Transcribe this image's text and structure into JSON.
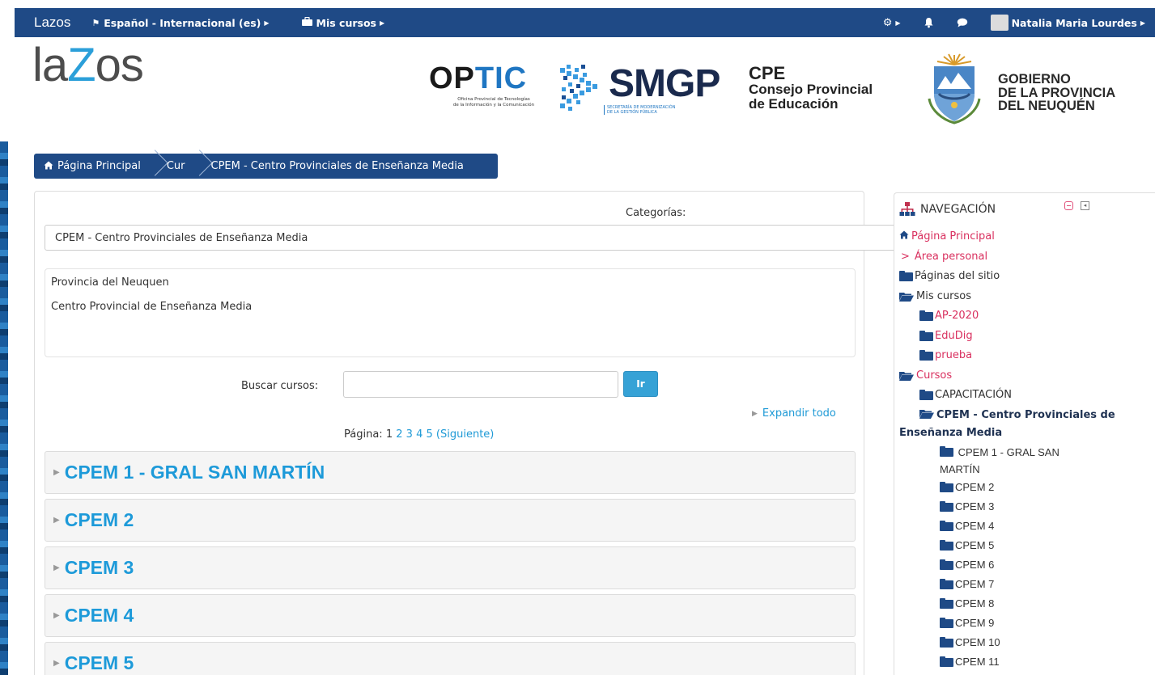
{
  "topbar": {
    "brand": "Lazos",
    "language": "Español - Internacional (es)",
    "my_courses": "Mis cursos",
    "user_name": "Natalia Maria Lourdes"
  },
  "header": {
    "logo_la": "la",
    "logo_z": "Z",
    "logo_os": "os",
    "optic_op": "OP",
    "optic_tic": "TIC",
    "optic_sub1": "Oficina Provincial de Tecnologías",
    "optic_sub2": "de la Información y la Comunicación",
    "smgp": "SMGP",
    "smgp_sub1": "SECRETARÍA DE MODERNIZACIÓN",
    "smgp_sub2": "DE LA GESTIÓN PÚBLICA",
    "cpe_a": "CPE",
    "cpe_b": "Consejo Provincial",
    "cpe_c": "de Educación",
    "gob_1": "GOBIERNO",
    "gob_2": "DE LA PROVINCIA",
    "gob_3": "DEL NEUQUÉN"
  },
  "breadcrumb": {
    "home": "Página Principal",
    "cur": "Cur",
    "current": "CPEM - Centro Provinciales de Enseñanza Media"
  },
  "main": {
    "categories_label": "Categorías:",
    "category_selected": "CPEM - Centro Provinciales de Enseñanza Media",
    "description_line1": "Provincia del Neuquen",
    "description_line2": "Centro Provincial de Enseñanza Media",
    "search_label": "Buscar cursos:",
    "search_value": "",
    "search_button": "Ir",
    "expand_all": "Expandir todo",
    "paging_label": "Página:",
    "pages": [
      "1",
      "2",
      "3",
      "4",
      "5"
    ],
    "next": "(Siguiente)",
    "courses": [
      "CPEM 1 - GRAL SAN MARTÍN",
      "CPEM 2",
      "CPEM 3",
      "CPEM 4",
      "CPEM 5"
    ]
  },
  "navigation": {
    "title": "NAVEGACIÓN",
    "home": "Página Principal",
    "personal": "Área personal",
    "site_pages": "Páginas del sitio",
    "my_courses": "Mis cursos",
    "my_courses_items": [
      "AP-2020",
      "EduDig",
      "prueba"
    ],
    "courses": "Cursos",
    "capacitacion": "CAPACITACIÓN",
    "cpem_category": "CPEM - Centro Provinciales de Enseñanza Media",
    "cpem_courses": [
      "CPEM 1 - GRAL SAN MARTÍN",
      "CPEM 2",
      "CPEM 3",
      "CPEM 4",
      "CPEM 5",
      "CPEM 6",
      "CPEM 7",
      "CPEM 8",
      "CPEM 9",
      "CPEM 10",
      "CPEM 11"
    ]
  },
  "colors": {
    "navbar": "#1f4a86",
    "link": "#1d9ad9",
    "accent_red": "#d9305f",
    "button": "#36a2d6"
  }
}
